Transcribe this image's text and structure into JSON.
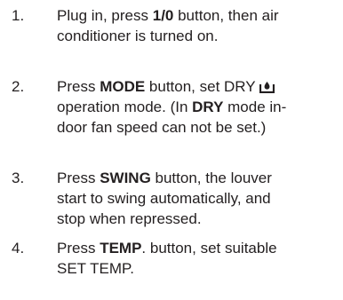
{
  "steps": [
    {
      "number": "1.",
      "line1_a": "Plug in, press ",
      "line1_b": "1/0",
      "line1_c": " button, then air",
      "line2": "conditioner is turned on."
    },
    {
      "number": "2.",
      "line1_a": "Press ",
      "line1_b": "MODE",
      "line1_c": " button, set DRY ",
      "icon": "dry-mode-icon",
      "line2": "operation mode. (In ",
      "line2_b": "DRY",
      "line2_c": " mode in-",
      "line3": "door fan speed can not be set.)"
    },
    {
      "number": "3.",
      "line1_a": "Press ",
      "line1_b": "SWING",
      "line1_c": " button, the louver",
      "line2": "start to swing automatically, and",
      "line3": "stop when repressed."
    },
    {
      "number": "4.",
      "line1_a": "Press ",
      "line1_b": "TEMP",
      "line1_c": ". button, set suitable",
      "line2": "SET TEMP."
    }
  ]
}
